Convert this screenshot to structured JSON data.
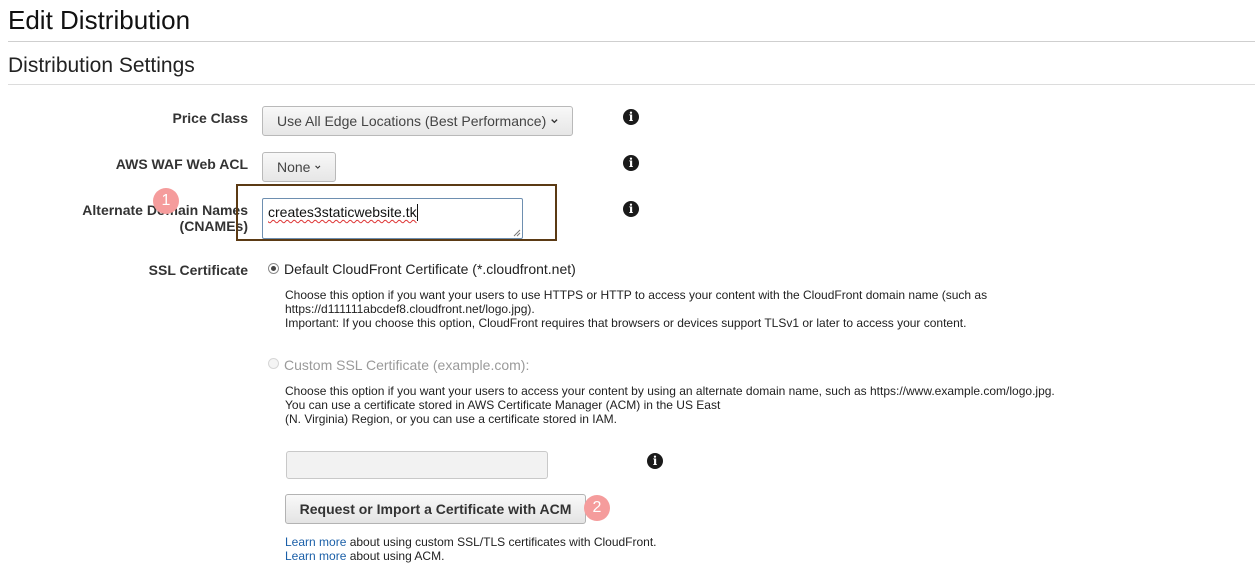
{
  "page_title": "Edit Distribution",
  "section_title": "Distribution Settings",
  "price_class": {
    "label": "Price Class",
    "value": "Use All Edge Locations (Best Performance)",
    "icon": "chevron-down-icon"
  },
  "waf": {
    "label": "AWS WAF Web ACL",
    "value": "None",
    "icon": "chevron-down-icon"
  },
  "cnames": {
    "label_line1": "Alternate Domain Names",
    "label_line2": "(CNAMEs)",
    "value": "creates3staticwebsite.tk"
  },
  "annotations": {
    "step1": "1",
    "step2": "2",
    "highlight_color": "#5b3a14",
    "badge_color": "#f59c9c"
  },
  "ssl": {
    "label": "SSL Certificate",
    "default_option": {
      "label": "Default CloudFront Certificate (*.cloudfront.net)",
      "selected": true,
      "desc_line1": "Choose this option if you want your users to use HTTPS or HTTP to access your content with the CloudFront domain name (such as",
      "desc_line2": "https://d111111abcdef8.cloudfront.net/logo.jpg).",
      "desc_line3": "Important: If you choose this option, CloudFront requires that browsers or devices support TLSv1 or later to access your content."
    },
    "custom_option": {
      "label": "Custom SSL Certificate (example.com):",
      "selected": false,
      "disabled": true,
      "desc_line1": "Choose this option if you want your users to access your content by using an alternate domain name, such as https://www.example.com/logo.jpg.",
      "desc_line2": "You can use a certificate stored in AWS Certificate Manager (ACM) in the US East",
      "desc_line3": "(N. Virginia) Region, or you can use a certificate stored in IAM.",
      "certificate_value": ""
    },
    "acm_button": "Request or Import a Certificate with ACM",
    "learn_more_1": {
      "link": "Learn more",
      "text": " about using custom SSL/TLS certificates with CloudFront."
    },
    "learn_more_2": {
      "link": "Learn more",
      "text": " about using ACM."
    }
  },
  "info_icon_glyph": "i",
  "link_color": "#1a5fa8"
}
